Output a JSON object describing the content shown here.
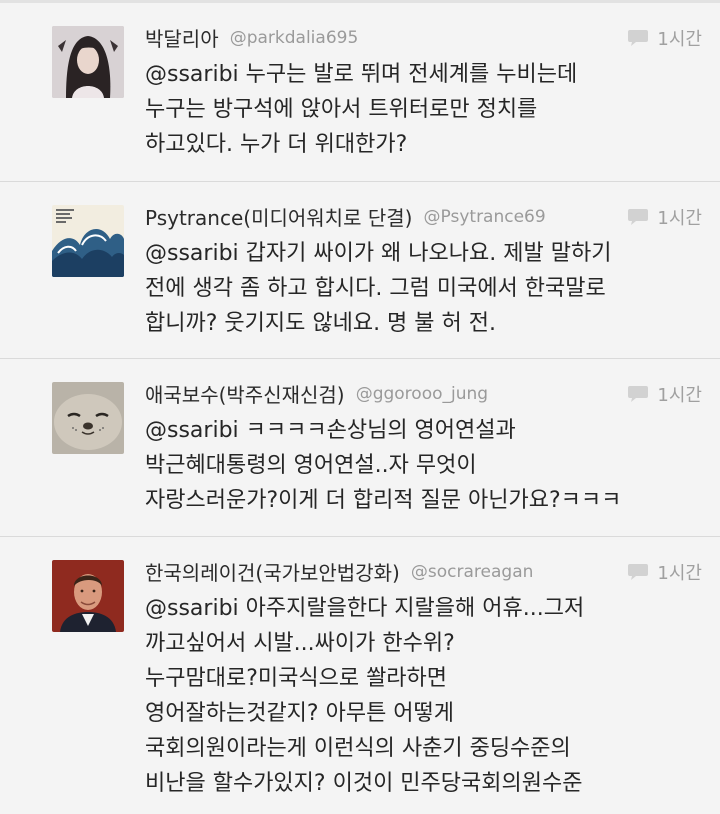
{
  "tweets": [
    {
      "name": "박달리아",
      "handle": "@parkdalia695",
      "time": "1시간",
      "avatar_icon": "woman-photo-avatar",
      "lines": [
        "@ssaribi 누구는 발로 뛰며 전세계를 누비는데",
        "누구는 방구석에 앉아서 트위터로만 정치를",
        "하고있다. 누가 더 위대한가?"
      ]
    },
    {
      "name": "Psytrance(미디어워치로 단결)",
      "handle": "@Psytrance69",
      "time": "1시간",
      "avatar_icon": "wave-album-avatar",
      "lines": [
        "@ssaribi 갑자기 싸이가 왜 나오나요. 제발 말하기",
        "전에 생각 좀 하고 합시다. 그럼 미국에서 한국말로",
        "합니까? 웃기지도 않네요. 명 불 허 전."
      ]
    },
    {
      "name": "애국보수(박주신재신검)",
      "handle": "@ggorooo_jung",
      "time": "1시간",
      "avatar_icon": "seal-photo-avatar",
      "lines": [
        "@ssaribi ㅋㅋㅋㅋ손상님의 영어연설과",
        "박근혜대통령의 영어연설..자 무엇이",
        "자랑스러운가?이게 더 합리적 질문 아닌가요?ㅋㅋㅋ"
      ]
    },
    {
      "name": "한국의레이건(국가보안법강화)",
      "handle": "@socrareagan",
      "time": "1시간",
      "avatar_icon": "man-portrait-avatar",
      "lines": [
        "@ssaribi 아주지랄을한다 지랄을해 어휴...그저",
        "까고싶어서 시발...싸이가  한수위?",
        "누구맘대로?미국식으로 쏼라하면",
        "영어잘하는것같지?  아무튼 어떻게",
        "국회의원이라는게 이런식의 사춘기 중딩수준의",
        "비난을 할수가있지? 이것이 민주당국회의원수준"
      ]
    }
  ]
}
